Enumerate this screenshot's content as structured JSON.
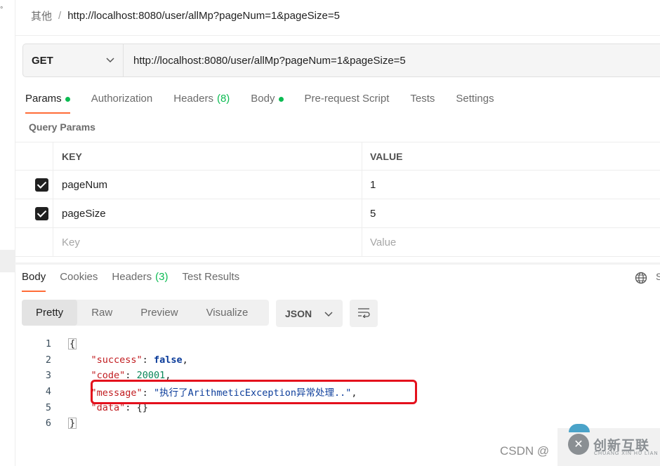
{
  "breadcrumb": {
    "parent": "其他",
    "separator": "/",
    "current": "http://localhost:8080/user/allMp?pageNum=1&pageSize=5"
  },
  "request": {
    "method": "GET",
    "url": "http://localhost:8080/user/allMp?pageNum=1&pageSize=5"
  },
  "request_tabs": {
    "params": "Params",
    "authorization": "Authorization",
    "headers": "Headers",
    "headers_count": "(8)",
    "body": "Body",
    "prerequest": "Pre-request Script",
    "tests": "Tests",
    "settings": "Settings"
  },
  "query_params": {
    "title": "Query Params",
    "col_key": "KEY",
    "col_value": "VALUE",
    "rows": [
      {
        "key": "pageNum",
        "value": "1",
        "checked": true
      },
      {
        "key": "pageSize",
        "value": "5",
        "checked": true
      }
    ],
    "placeholder_key": "Key",
    "placeholder_value": "Value"
  },
  "response_tabs": {
    "body": "Body",
    "cookies": "Cookies",
    "headers": "Headers",
    "headers_count": "(3)",
    "test_results": "Test Results",
    "overflow": "S"
  },
  "view_modes": {
    "pretty": "Pretty",
    "raw": "Raw",
    "preview": "Preview",
    "visualize": "Visualize"
  },
  "format": "JSON",
  "code": {
    "line_numbers": [
      "1",
      "2",
      "3",
      "4",
      "5",
      "6"
    ],
    "open": "{",
    "success_key": "\"success\"",
    "success_val": "false",
    "code_key": "\"code\"",
    "code_val": "20001",
    "message_key": "\"message\"",
    "message_val": "\"执行了ArithmeticException异常处理..\"",
    "data_key": "\"data\"",
    "data_val": "{}",
    "close": "}"
  },
  "watermark": {
    "csdn": "CSDN @",
    "cn": "创新互联",
    "en": "CHUANG XIN HU LIAN",
    "logo": "✕"
  },
  "colors": {
    "accent": "#ff6c37",
    "green": "#0cbb52",
    "highlight": "#e4101c"
  }
}
